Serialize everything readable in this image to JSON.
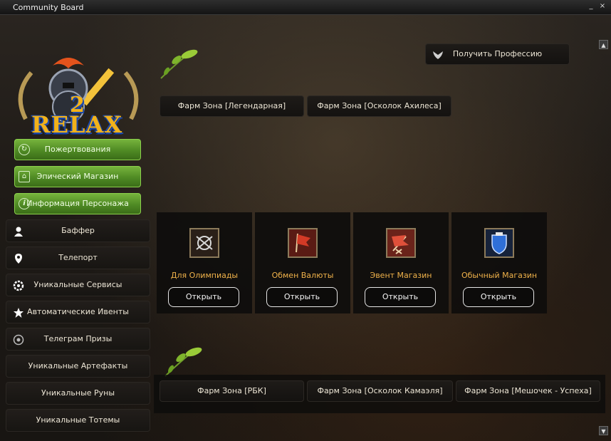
{
  "window": {
    "title": "Community Board",
    "minimize": "_",
    "close": "×"
  },
  "logo": {
    "text_top": "2",
    "text_bottom": "RELAX",
    "colors": {
      "gold": "#f2b21a",
      "blue": "#1f4aa8"
    }
  },
  "sidebar_green": [
    {
      "label": "Пожертвования",
      "icon": "refresh-icon"
    },
    {
      "label": "Эпический Магазин",
      "icon": "basket-icon"
    },
    {
      "label": "Информация Персонажа",
      "icon": "info-icon"
    }
  ],
  "sidebar": [
    {
      "label": "Баффер",
      "icon": "person-icon"
    },
    {
      "label": "Телепорт",
      "icon": "map-pin-icon"
    },
    {
      "label": "Уникальные Сервисы",
      "icon": "gear-icon"
    },
    {
      "label": "Автоматические Ивенты",
      "icon": "star-icon"
    },
    {
      "label": "Телеграм Призы",
      "icon": "telegram-icon"
    },
    {
      "label": "Уникальные Артефакты",
      "icon": ""
    },
    {
      "label": "Уникальные Руны",
      "icon": ""
    },
    {
      "label": "Уникальные Тотемы",
      "icon": ""
    }
  ],
  "profession": {
    "label": "Получить Профессию",
    "icon": "wings-icon"
  },
  "farm_top": [
    "Фарм Зона [Легендарная]",
    "Фарм Зона [Осколок Ахилеса]"
  ],
  "cards": [
    {
      "label": "Для Олимпиады",
      "button": "Открыть",
      "icon": "olympiad-icon"
    },
    {
      "label": "Обмен Валюты",
      "button": "Открыть",
      "icon": "flag-icon"
    },
    {
      "label": "Эвент Магазин",
      "button": "Открыть",
      "icon": "event-flag-icon"
    },
    {
      "label": "Обычный Магазин",
      "button": "Открыть",
      "icon": "shield-icon"
    }
  ],
  "farm_bottom": [
    "Фарм Зона [РБК]",
    "Фарм Зона [Осколок Камаэля]",
    "Фарм Зона [Мешочек - Успеха]"
  ],
  "scroll": {
    "up": "▲",
    "down": "▼"
  },
  "accent": {
    "card_label": "#f0b24a",
    "green_button": "#4f8a24"
  }
}
